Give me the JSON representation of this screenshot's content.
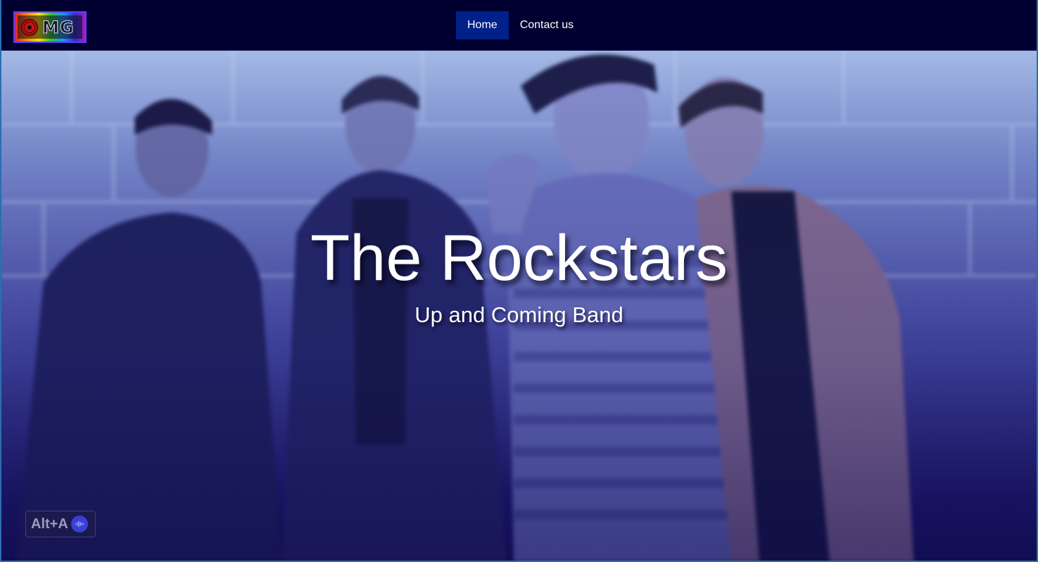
{
  "navbar": {
    "logo": {
      "text": "MG",
      "icon": "vinyl-record-icon"
    },
    "links": [
      {
        "label": "Home",
        "active": true
      },
      {
        "label": "Contact us",
        "active": false
      }
    ],
    "background_color": "#000030",
    "active_color": "#00208a"
  },
  "hero": {
    "title": "The Rockstars",
    "subtitle": "Up and Coming Band",
    "background_image": "band-photo-four-members-blue-tint"
  },
  "accessibility_widget": {
    "label": "Alt+A",
    "icon": "audio-wave-icon"
  }
}
